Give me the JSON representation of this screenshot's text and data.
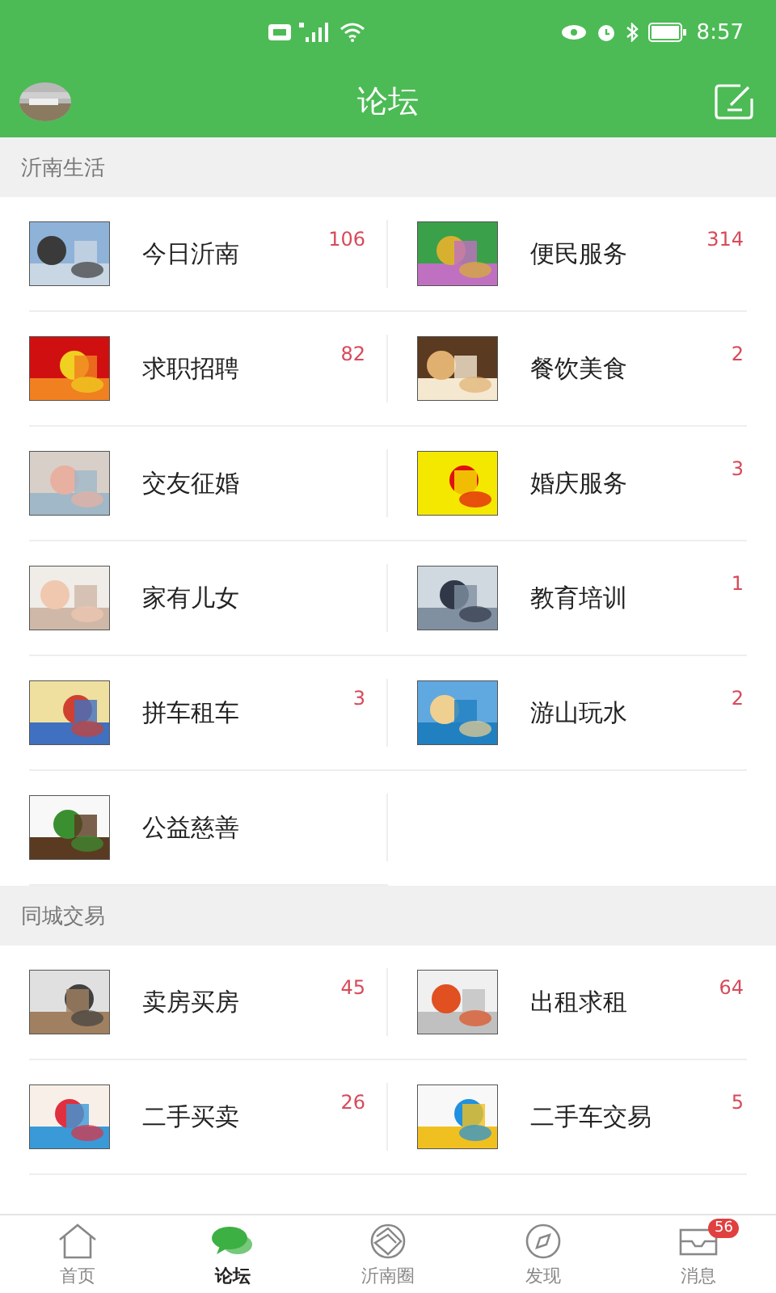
{
  "status_bar": {
    "time": "8:57"
  },
  "header": {
    "title": "论坛"
  },
  "sections": [
    {
      "title": "沂南生活",
      "items": [
        {
          "label": "今日沂南",
          "count": "106"
        },
        {
          "label": "便民服务",
          "count": "314"
        },
        {
          "label": "求职招聘",
          "count": "82"
        },
        {
          "label": "餐饮美食",
          "count": "2"
        },
        {
          "label": "交友征婚"
        },
        {
          "label": "婚庆服务",
          "count": "3"
        },
        {
          "label": "家有儿女"
        },
        {
          "label": "教育培训",
          "count": "1"
        },
        {
          "label": "拼车租车",
          "count": "3"
        },
        {
          "label": "游山玩水",
          "count": "2"
        },
        {
          "label": "公益慈善"
        }
      ]
    },
    {
      "title": "同城交易",
      "items": [
        {
          "label": "卖房买房",
          "count": "45"
        },
        {
          "label": "出租求租",
          "count": "64"
        },
        {
          "label": "二手买卖",
          "count": "26"
        },
        {
          "label": "二手车交易",
          "count": "5"
        }
      ]
    }
  ],
  "tabs": [
    {
      "label": "首页",
      "selected": false
    },
    {
      "label": "论坛",
      "selected": true
    },
    {
      "label": "沂南圈",
      "selected": false
    },
    {
      "label": "发现",
      "selected": false
    },
    {
      "label": "消息",
      "selected": false,
      "badge": "56"
    }
  ]
}
